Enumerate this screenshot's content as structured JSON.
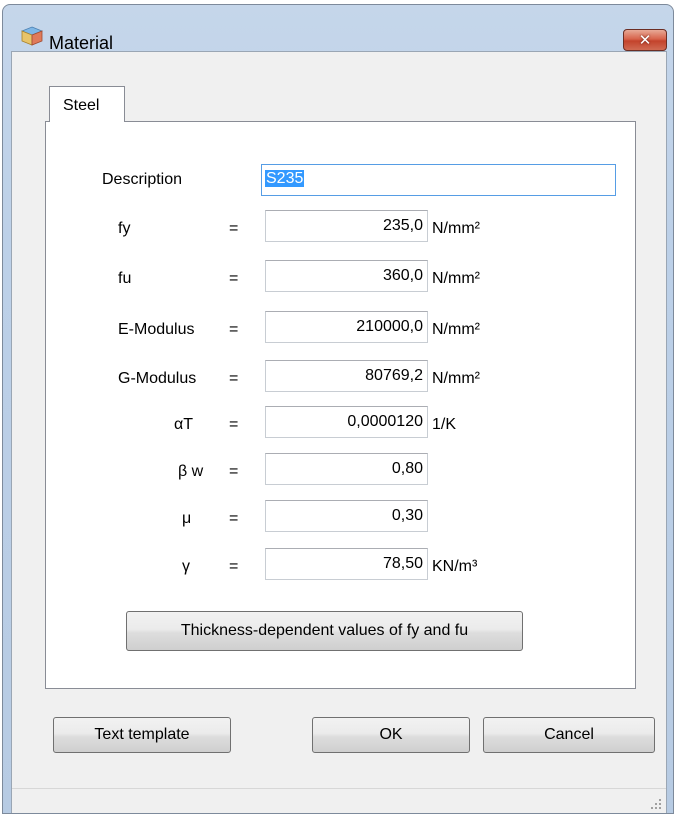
{
  "window": {
    "title": "Material",
    "close_glyph": "✕",
    "icon": "material-cube-icon"
  },
  "tab": {
    "label": "Steel"
  },
  "form": {
    "description_label": "Description",
    "description_value": "S235",
    "rows": [
      {
        "symbol": "fy",
        "eq": "=",
        "value": "235,0",
        "unit": "N/mm²"
      },
      {
        "symbol": "fu",
        "eq": "=",
        "value": "360,0",
        "unit": "N/mm²"
      },
      {
        "symbol": "E-Modulus",
        "eq": "=",
        "value": "210000,0",
        "unit": "N/mm²"
      },
      {
        "symbol": "G-Modulus",
        "eq": "=",
        "value": "80769,2",
        "unit": "N/mm²"
      },
      {
        "symbol": "αT",
        "eq": "=",
        "value": "0,0000120",
        "unit": "1/K"
      },
      {
        "symbol": "β w",
        "eq": "=",
        "value": "0,80",
        "unit": ""
      },
      {
        "symbol": "μ",
        "eq": "=",
        "value": "0,30",
        "unit": ""
      },
      {
        "symbol": "γ",
        "eq": "=",
        "value": "78,50",
        "unit": "KN/m³"
      }
    ],
    "thickness_button": "Thickness-dependent values of fy and fu"
  },
  "buttons": {
    "text_template": "Text template",
    "ok": "OK",
    "cancel": "Cancel"
  },
  "colors": {
    "selection": "#3399ff",
    "focus_border": "#569de5",
    "close_button": "#c3432c"
  }
}
